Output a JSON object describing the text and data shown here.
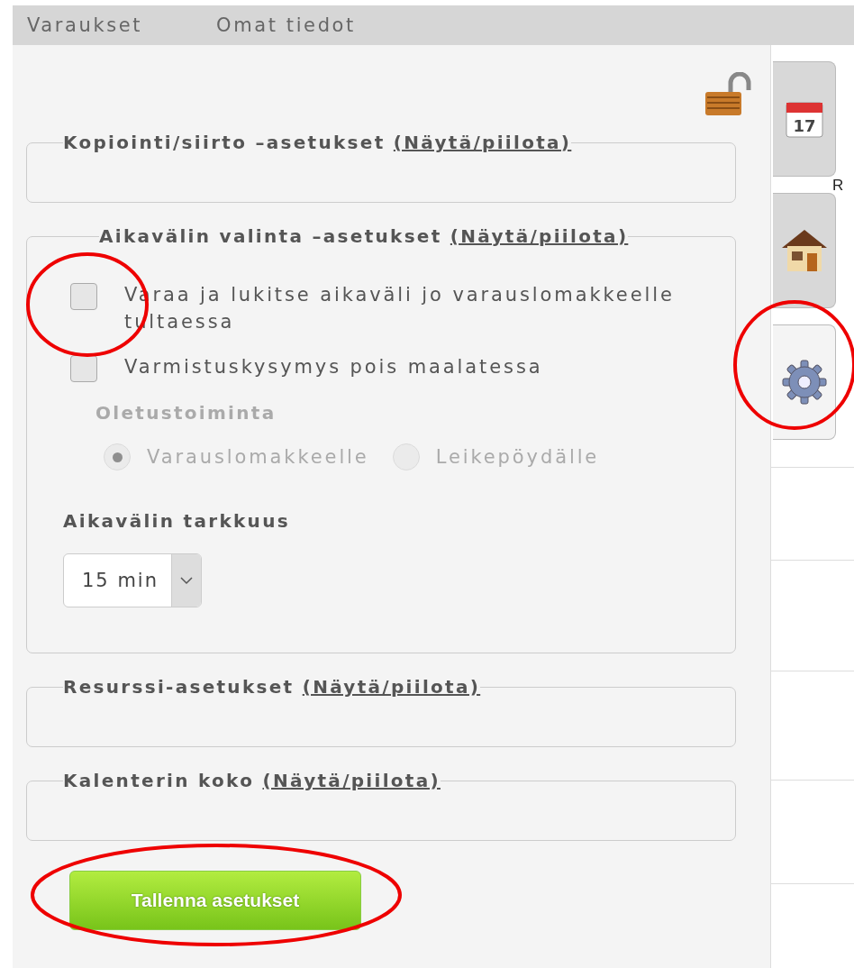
{
  "nav": [
    {
      "label": "Varaukset"
    },
    {
      "label": "Omat tiedot"
    }
  ],
  "lock": {
    "locked": false
  },
  "sections": [
    {
      "title": "Kopiointi/siirto –asetukset",
      "toggle": "(Näytä/piilota)",
      "expanded": false
    },
    {
      "title": "Aikavälin valinta –asetukset",
      "toggle": "(Näytä/piilota)",
      "expanded": true,
      "options": [
        {
          "label": "Varaa ja lukitse aikaväli jo varauslomakkeelle tultaessa",
          "checked": false
        },
        {
          "label": "Varmistuskysymys pois maalatessa",
          "checked": false
        }
      ],
      "default_action": {
        "label": "Oletustoiminta",
        "disabled": true,
        "choices": [
          {
            "label": "Varauslomakkeelle",
            "selected": true
          },
          {
            "label": "Leikepöydälle",
            "selected": false
          }
        ]
      },
      "precision": {
        "label": "Aikavälin tarkkuus",
        "value": "15 min"
      }
    },
    {
      "title": "Resurssi-asetukset",
      "toggle": "(Näytä/piilota)",
      "expanded": false
    },
    {
      "title": "Kalenterin koko",
      "toggle": "(Näytä/piilota)",
      "expanded": false
    }
  ],
  "save_button": "Tallenna asetukset",
  "side_tabs": [
    {
      "kind": "calendar",
      "day": "17",
      "selected": false
    },
    {
      "kind": "home",
      "selected": false
    },
    {
      "kind": "settings",
      "selected": true
    }
  ],
  "edge_text": "R"
}
